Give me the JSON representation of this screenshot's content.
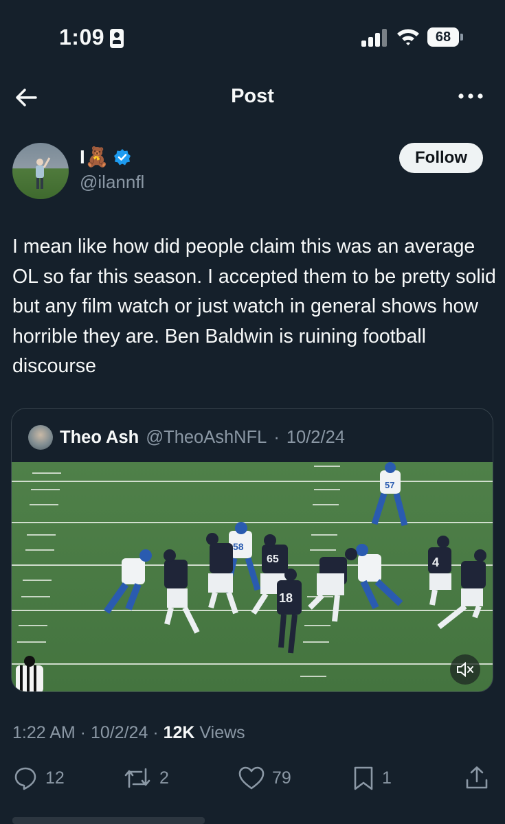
{
  "status_bar": {
    "time": "1:09",
    "battery": "68"
  },
  "header": {
    "title": "Post",
    "back_icon": "arrow-left-icon",
    "more_icon": "more-horizontal-icon"
  },
  "author": {
    "name": "I🧸",
    "handle": "@ilannfl",
    "verified": true,
    "follow_label": "Follow"
  },
  "post": {
    "text": "I mean like how did people claim this was an average OL so far this season. I accepted them to be pretty solid but any film watch or just watch in general shows how horrible they are. Ben Baldwin is ruining football discourse"
  },
  "quote": {
    "name": "Theo Ash",
    "handle": "@TheoAshNFL",
    "separator": "·",
    "date": "10/2/24",
    "jersey_numbers": [
      "57",
      "58",
      "65",
      "18",
      "4"
    ]
  },
  "meta": {
    "time": "1:22 AM",
    "date": "10/2/24",
    "separator": " · ",
    "views_count": "12K",
    "views_label": " Views"
  },
  "actions": {
    "replies": "12",
    "reposts": "2",
    "likes": "79",
    "bookmarks": "1"
  },
  "colors": {
    "background": "#15202b",
    "text": "#f7f9f9",
    "muted": "#8b98a5",
    "verified": "#1d9bf0"
  }
}
